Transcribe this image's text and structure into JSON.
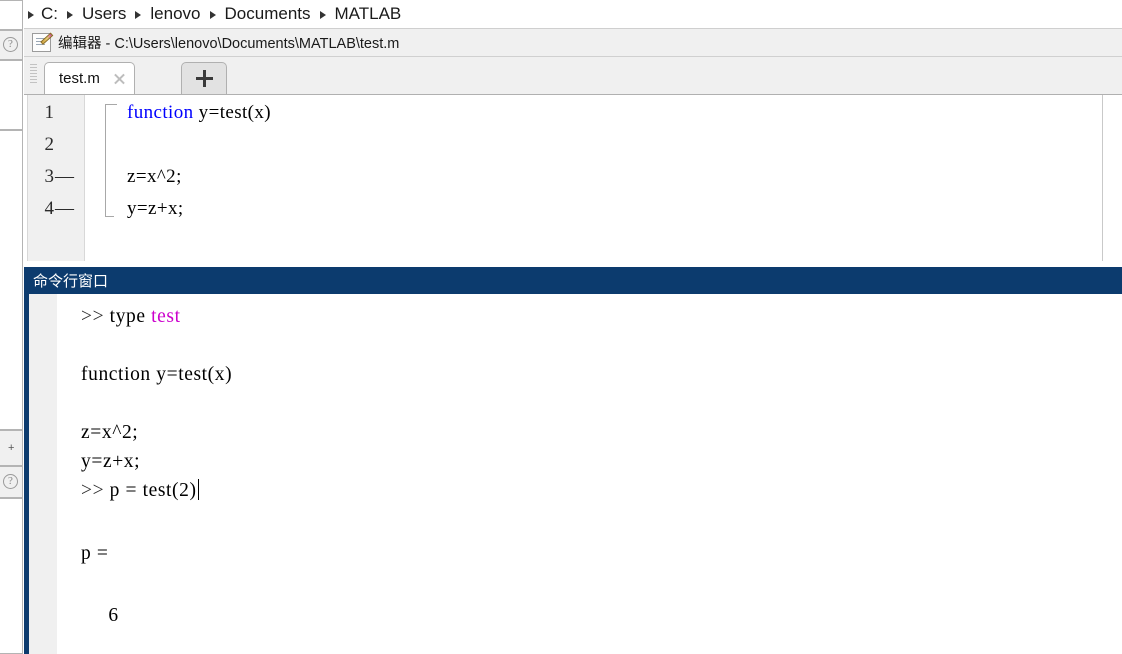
{
  "breadcrumb": {
    "name": "path-breadcrumb",
    "items": [
      "C:",
      "Users",
      "lenovo",
      "Documents",
      "MATLAB"
    ]
  },
  "editor": {
    "title_prefix": "编辑器",
    "title_separator": " - ",
    "file_path": "C:\\Users\\lenovo\\Documents\\MATLAB\\test.m",
    "title_full": "编辑器 - C:\\Users\\lenovo\\Documents\\MATLAB\\test.m",
    "tabs": [
      {
        "label": "test.m",
        "active": true,
        "closable": true
      }
    ],
    "new_tab_label": "+",
    "lines": [
      {
        "number": "1",
        "executable": false,
        "segments": [
          {
            "text": "function",
            "style": "keyword"
          },
          {
            "text": " y=test(x)",
            "style": "plain"
          }
        ]
      },
      {
        "number": "2",
        "executable": false,
        "segments": [
          {
            "text": "",
            "style": "plain"
          }
        ]
      },
      {
        "number": "3",
        "executable": true,
        "marker": "—",
        "segments": [
          {
            "text": "z=x^2;",
            "style": "plain"
          }
        ]
      },
      {
        "number": "4",
        "executable": true,
        "marker": "—",
        "segments": [
          {
            "text": "y=z+x;",
            "style": "plain"
          }
        ]
      }
    ]
  },
  "command_window": {
    "title": "命令行窗口",
    "lines": [
      {
        "indent": 0,
        "segments": [
          {
            "text": ">> ",
            "style": "prompt"
          },
          {
            "text": "type ",
            "style": "plain"
          },
          {
            "text": "test",
            "style": "function-name"
          }
        ]
      },
      {
        "indent": 0,
        "segments": [
          {
            "text": "",
            "style": "plain"
          }
        ]
      },
      {
        "indent": 0,
        "segments": [
          {
            "text": "function y=test(x)",
            "style": "plain"
          }
        ]
      },
      {
        "indent": 0,
        "segments": [
          {
            "text": "",
            "style": "plain"
          }
        ]
      },
      {
        "indent": 0,
        "segments": [
          {
            "text": "z=x^2;",
            "style": "plain"
          }
        ]
      },
      {
        "indent": 0,
        "segments": [
          {
            "text": "y=z+x;",
            "style": "plain"
          }
        ]
      },
      {
        "indent": 0,
        "cursor": true,
        "segments": [
          {
            "text": ">> ",
            "style": "prompt"
          },
          {
            "text": "p = test(2)",
            "style": "plain"
          }
        ]
      },
      {
        "indent": 0,
        "segments": [
          {
            "text": "",
            "style": "plain"
          }
        ]
      },
      {
        "indent": 0,
        "segments": [
          {
            "text": "p =",
            "style": "plain"
          }
        ]
      },
      {
        "indent": 0,
        "segments": [
          {
            "text": "",
            "style": "plain"
          }
        ]
      },
      {
        "indent": 0,
        "segments": [
          {
            "text": "     6",
            "style": "plain"
          }
        ]
      }
    ]
  },
  "side_panels": {
    "help_icon_label": "?",
    "expand_icon_label": "+"
  },
  "colors": {
    "titlebar_navy": "#0c3b6e",
    "keyword_blue": "#0000ff",
    "function_magenta": "#cc00cc",
    "panel_gray": "#f0f0f0",
    "text_black": "#000000"
  }
}
